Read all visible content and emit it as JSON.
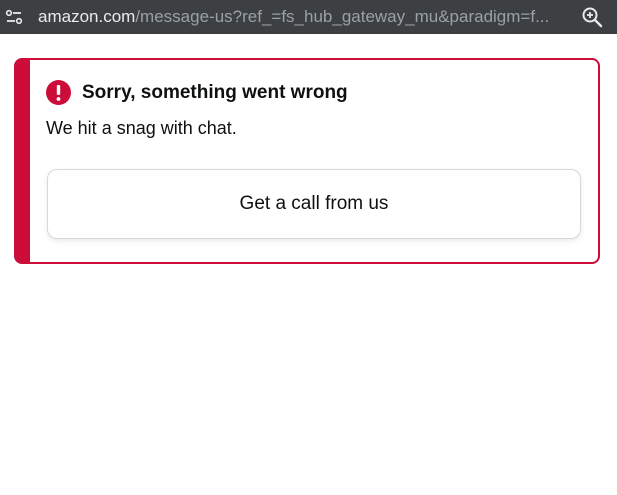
{
  "browser": {
    "url_host": "amazon.com",
    "url_rest": "/message-us?ref_=fs_hub_gateway_mu&paradigm=f...",
    "site_info_icon": "tune-icon",
    "zoom_icon": "zoom-in-icon"
  },
  "alert": {
    "icon": "exclamation-icon",
    "title": "Sorry, something went wrong",
    "message": "We hit a snag with chat.",
    "button_label": "Get a call from us",
    "accent_color": "#cc0c39"
  }
}
